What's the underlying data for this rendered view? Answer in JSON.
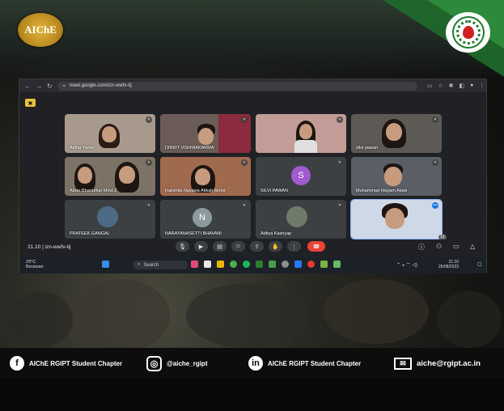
{
  "poster": {
    "logo_left_text": "AIChE",
    "accent_green": "#1f6b2c"
  },
  "browser": {
    "url": "meet.google.com/izn-wwfv-tij",
    "meet_code": "21.10 | izn-wwfv-tij"
  },
  "participants": [
    {
      "name": "Astha Yadav"
    },
    {
      "name": "DINKIT VISHWAKARMA"
    },
    {
      "name": ""
    },
    {
      "name": "silvi pawan"
    },
    {
      "name": "Abrar Bhanurkar Mind Z"
    },
    {
      "name": "Rakshita Nayasia Atikah Mohd"
    },
    {
      "name": "SILVI PAWAN",
      "avatar": "S"
    },
    {
      "name": "Muhammad Hisyam Alawi"
    },
    {
      "name": "PRATEEK GANGAL"
    },
    {
      "name": "NARAYANASETTI BHAVANI",
      "avatar": "N"
    },
    {
      "name": "Aditya Kashyap"
    },
    {
      "name": ""
    }
  ],
  "controls": {
    "people_count": "12"
  },
  "taskbar": {
    "temperature": "29°C",
    "weather": "Berawan",
    "search_label": "Search",
    "time": "21:10",
    "date": "26/08/2023"
  },
  "footer": {
    "facebook": "AIChE RGIPT Student Chapter",
    "instagram": "@aiche_rgipt",
    "linkedin": "AIChE RGIPT Student Chapter",
    "email": "aiche@rgipt.ac.in"
  }
}
